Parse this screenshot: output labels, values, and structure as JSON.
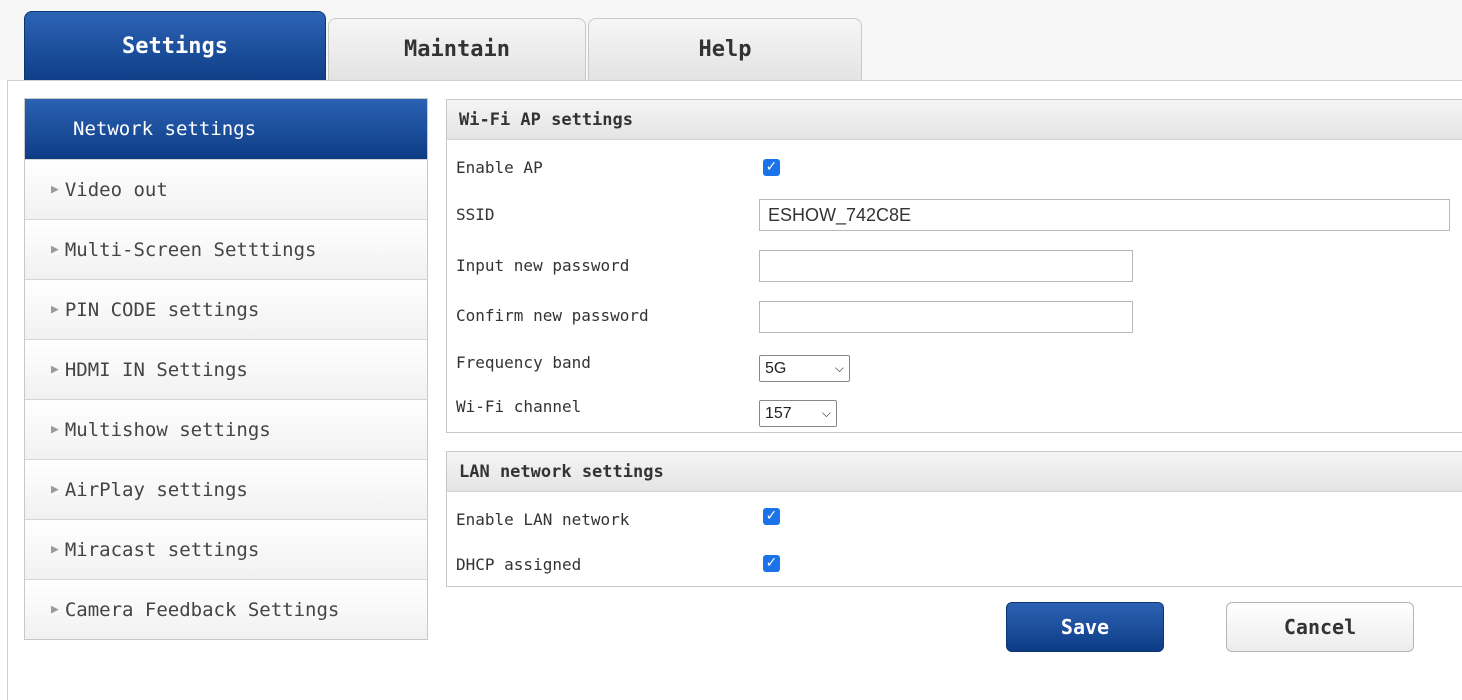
{
  "tabs": [
    {
      "label": "Settings",
      "active": true
    },
    {
      "label": "Maintain",
      "active": false
    },
    {
      "label": "Help",
      "active": false
    }
  ],
  "sidebar": {
    "items": [
      {
        "label": "Network settings",
        "active": true
      },
      {
        "label": "Video out",
        "active": false
      },
      {
        "label": "Multi-Screen Setttings",
        "active": false
      },
      {
        "label": "PIN CODE settings",
        "active": false
      },
      {
        "label": "HDMI IN Settings",
        "active": false
      },
      {
        "label": "Multishow settings",
        "active": false
      },
      {
        "label": "AirPlay settings",
        "active": false
      },
      {
        "label": "Miracast settings",
        "active": false
      },
      {
        "label": "Camera Feedback Settings",
        "active": false
      }
    ],
    "arrow_glyph": "▶"
  },
  "wifi": {
    "title": "Wi-Fi AP settings",
    "enable_ap_label": "Enable AP",
    "enable_ap_checked": true,
    "ssid_label": "SSID",
    "ssid_value": "ESHOW_742C8E",
    "new_password_label": "Input new password",
    "new_password_value": "",
    "confirm_password_label": "Confirm new password",
    "confirm_password_value": "",
    "band_label": "Frequency band",
    "band_value": "5G",
    "channel_label": "Wi-Fi channel",
    "channel_value": "157"
  },
  "lan": {
    "title": "LAN network settings",
    "enable_lan_label": "Enable LAN network",
    "enable_lan_checked": true,
    "dhcp_label": "DHCP assigned",
    "dhcp_checked": true
  },
  "actions": {
    "save_label": "Save",
    "cancel_label": "Cancel"
  },
  "glyphs": {
    "check": "✓",
    "chevron_down": "⌵"
  },
  "colors": {
    "accent": "#1a4f9c",
    "checkbox": "#1a73e8"
  }
}
